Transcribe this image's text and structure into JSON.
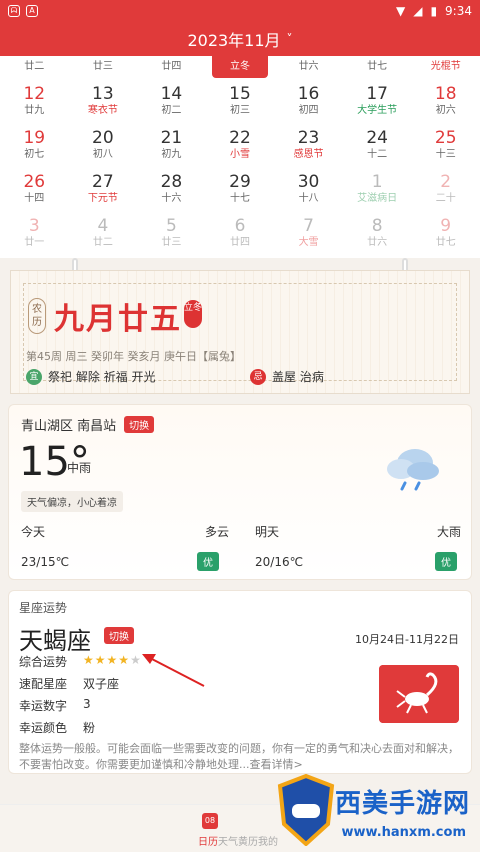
{
  "status": {
    "time": "9:34",
    "left_icons": [
      "mail-icon",
      "a-icon"
    ]
  },
  "header": {
    "title": "2023年11月",
    "chevron": "˅"
  },
  "calendar": {
    "partial_row": [
      {
        "sub": "廿二"
      },
      {
        "sub": "廿三"
      },
      {
        "sub": "廿四"
      },
      {
        "sub": "立冬",
        "selected": true
      },
      {
        "sub": "廿六"
      },
      {
        "sub": "廿七"
      },
      {
        "sub": "光棍节",
        "festival": true
      }
    ],
    "rows": [
      [
        {
          "num": "12",
          "sub": "廿九",
          "weekend": true
        },
        {
          "num": "13",
          "sub": "寒衣节",
          "red": true
        },
        {
          "num": "14",
          "sub": "初二"
        },
        {
          "num": "15",
          "sub": "初三"
        },
        {
          "num": "16",
          "sub": "初四"
        },
        {
          "num": "17",
          "sub": "大学生节",
          "green": true
        },
        {
          "num": "18",
          "sub": "初六",
          "weekend": true
        }
      ],
      [
        {
          "num": "19",
          "sub": "初七",
          "weekend": true
        },
        {
          "num": "20",
          "sub": "初八"
        },
        {
          "num": "21",
          "sub": "初九"
        },
        {
          "num": "22",
          "sub": "小雪",
          "red": true
        },
        {
          "num": "23",
          "sub": "感恩节",
          "red": true
        },
        {
          "num": "24",
          "sub": "十二"
        },
        {
          "num": "25",
          "sub": "十三",
          "weekend": true
        }
      ],
      [
        {
          "num": "26",
          "sub": "十四",
          "weekend": true
        },
        {
          "num": "27",
          "sub": "下元节",
          "red": true
        },
        {
          "num": "28",
          "sub": "十六"
        },
        {
          "num": "29",
          "sub": "十七"
        },
        {
          "num": "30",
          "sub": "十八"
        },
        {
          "num": "1",
          "sub": "艾滋病日",
          "dim": true,
          "dimgreen": true
        },
        {
          "num": "2",
          "sub": "二十",
          "dim": true,
          "weekend": true
        }
      ],
      [
        {
          "num": "3",
          "sub": "廿一",
          "dim": true,
          "weekend": true
        },
        {
          "num": "4",
          "sub": "廿二",
          "dim": true
        },
        {
          "num": "5",
          "sub": "廿三",
          "dim": true
        },
        {
          "num": "6",
          "sub": "廿四",
          "dim": true
        },
        {
          "num": "7",
          "sub": "大雪",
          "dim": true,
          "red": true
        },
        {
          "num": "8",
          "sub": "廿六",
          "dim": true
        },
        {
          "num": "9",
          "sub": "廿七",
          "dim": true,
          "weekend": true
        }
      ]
    ]
  },
  "almanac": {
    "badge": "农历",
    "lunar_date": "九月廿五",
    "term": "立冬",
    "line": "第45周 周三 癸卯年 癸亥月 庚午日【属兔】",
    "yi_label": "宜",
    "yi": "祭祀 解除 祈福 开光",
    "ji_label": "忌",
    "ji": "盖屋 治病"
  },
  "weather": {
    "location": "青山湖区 南昌站",
    "switch": "切换",
    "temp": "15°",
    "condition": "中雨",
    "tip": "天气偏凉，小心着凉",
    "today_label": "今天",
    "today_cond": "多云",
    "today_range": "23/15℃",
    "today_quality": "优",
    "tomorrow_label": "明天",
    "tomorrow_cond": "大雨",
    "tomorrow_range": "20/16℃",
    "tomorrow_quality": "优"
  },
  "horoscope": {
    "title": "星座运势",
    "sign": "天蝎座",
    "switch": "切换",
    "range": "10月24日-11月22日",
    "overall_label": "综合运势",
    "overall_rating": 4,
    "overall_max": 5,
    "match_label": "速配星座",
    "match": "双子座",
    "number_label": "幸运数字",
    "number": "3",
    "color_label": "幸运颜色",
    "color": "粉",
    "summary": "整体运势一般般。可能会面临一些需要改变的问题，你有一定的勇气和决心去面对和解决，不要害怕改变。你需要更加谨慎和冷静地处理...查看详情>"
  },
  "bottom": {
    "icon_text": "08",
    "label_red": "日历",
    "label": "天气黄历我的"
  },
  "watermark": {
    "text": "西美手游网",
    "url": "www.hanxm.com"
  }
}
